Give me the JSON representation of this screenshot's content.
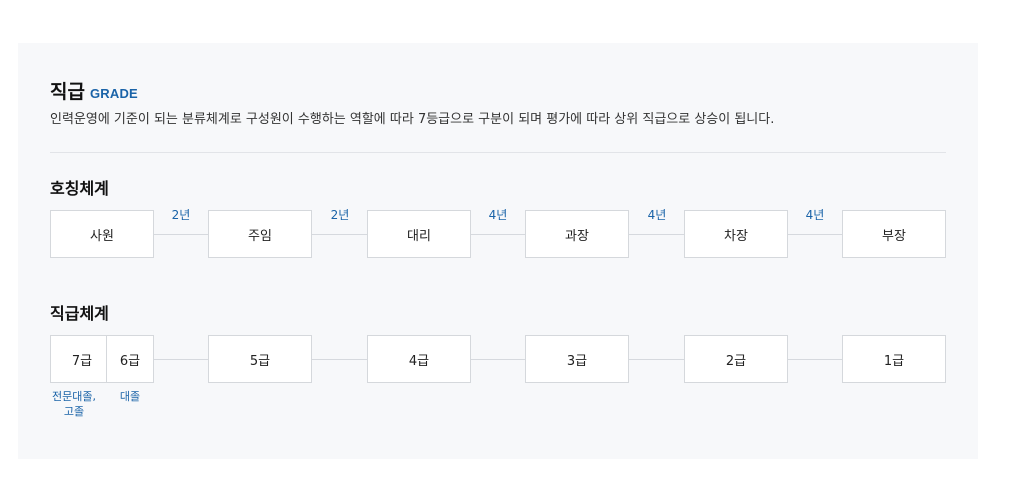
{
  "header": {
    "title": "직급",
    "title_en": "GRADE",
    "description": "인력운영에 기준이 되는 분류체계로 구성원이 수행하는 역할에 따라 7등급으로 구분이 되며 평가에 따라 상위 직급으로 상승이 됩니다."
  },
  "title_system": {
    "heading": "호칭체계",
    "positions": [
      "사원",
      "주임",
      "대리",
      "과장",
      "차장",
      "부장"
    ],
    "years": [
      "2년",
      "2년",
      "4년",
      "4년",
      "4년"
    ]
  },
  "grade_system": {
    "heading": "직급체계",
    "grades": [
      "7급",
      "6급",
      "5급",
      "4급",
      "3급",
      "2급",
      "1급"
    ],
    "notes": {
      "grade7_line1": "전문대졸,",
      "grade7_line2": "고졸",
      "grade6": "대졸"
    }
  },
  "colors": {
    "accent": "#1a63a8",
    "panel_bg": "#f7f8fa",
    "box_border": "#d5d8dc"
  }
}
